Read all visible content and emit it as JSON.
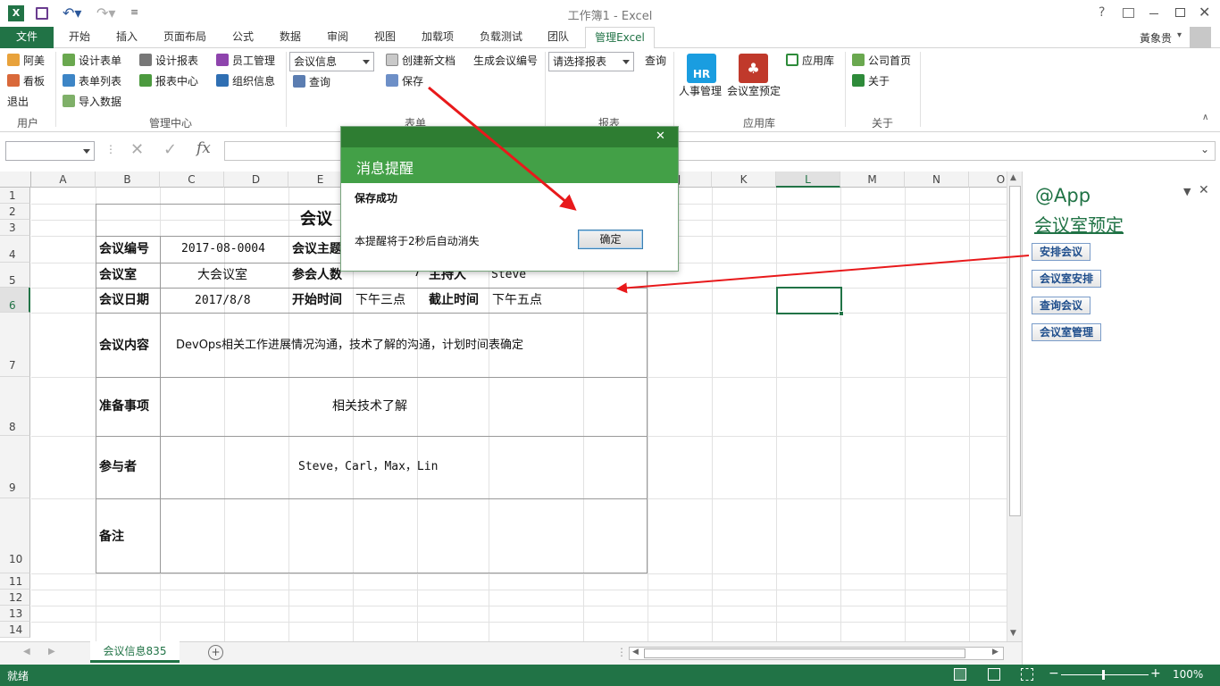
{
  "window": {
    "title": "工作簿1 - Excel",
    "user": "黃象贵"
  },
  "titlebar_icons": [
    "help-icon",
    "ribbon-display-icon",
    "minimize-icon",
    "maximize-icon",
    "close-icon"
  ],
  "tabs": [
    "文件",
    "开始",
    "插入",
    "页面布局",
    "公式",
    "数据",
    "审阅",
    "视图",
    "加载项",
    "负载测试",
    "团队",
    "管理Excel"
  ],
  "ribbon": {
    "user_group": {
      "items": [
        "阿美",
        "看板",
        "退出"
      ],
      "label": "用户"
    },
    "manage_group": {
      "items": [
        "设计表单",
        "表单列表",
        "导入数据",
        "设计报表",
        "报表中心",
        "员工管理",
        "组织信息"
      ],
      "label": "管理中心"
    },
    "form_group": {
      "combo": "会议信息",
      "query": "查询",
      "create": "创建新文档",
      "save": "保存",
      "gen": "生成会议编号",
      "label": "表单"
    },
    "report_group": {
      "combo": "请选择报表",
      "query": "查询",
      "label": "报表"
    },
    "app_group": {
      "hr": "人事管理",
      "meeting": "会议室预定",
      "lib": "应用库",
      "label": "应用库"
    },
    "about_group": {
      "home": "公司首页",
      "about": "关于",
      "label": "关于"
    }
  },
  "formula_bar": {
    "fx": "fx",
    "name_box": ""
  },
  "columns": [
    "A",
    "B",
    "C",
    "D",
    "E",
    "F",
    "G",
    "H",
    "I",
    "J",
    "K",
    "L",
    "M",
    "N",
    "O"
  ],
  "rows": [
    "1",
    "2",
    "3",
    "4",
    "5",
    "6",
    "7",
    "8",
    "9",
    "10",
    "11",
    "12",
    "13",
    "14"
  ],
  "sheet": {
    "title": "会议",
    "labels": {
      "no": "会议编号",
      "topic": "会议主题",
      "room": "会议室",
      "count": "参会人数",
      "host": "主持人",
      "date": "会议日期",
      "start": "开始时间",
      "end": "截止时间",
      "content": "会议内容",
      "prep": "准备事项",
      "people": "参与者",
      "note": "备注"
    },
    "values": {
      "no": "2017-08-0004",
      "room": "大会议室",
      "count": "7",
      "host": "Steve",
      "date": "2017/8/8",
      "start": "下午三点",
      "end": "下午五点",
      "content": "DevOps相关工作进展情况沟通，技术了解的沟通，计划时间表确定",
      "prep": "相关技术了解",
      "people": "Steve，Carl，Max，Lin"
    }
  },
  "sheet_tab": "会议信息835",
  "status": {
    "ready": "就绪",
    "zoom": "100%"
  },
  "pane": {
    "title": "@App",
    "link": "会议室预定",
    "buttons": [
      "安排会议",
      "会议室安排",
      "查询会议",
      "会议室管理"
    ]
  },
  "dialog": {
    "title": "消息提醒",
    "heading": "保存成功",
    "message": "本提醒将于2秒后自动消失",
    "ok": "确定"
  },
  "colors": {
    "excel_green": "#217346",
    "dialog_green": "#43a047",
    "dialog_head": "#2e7d32",
    "arrow": "#e8191b"
  }
}
